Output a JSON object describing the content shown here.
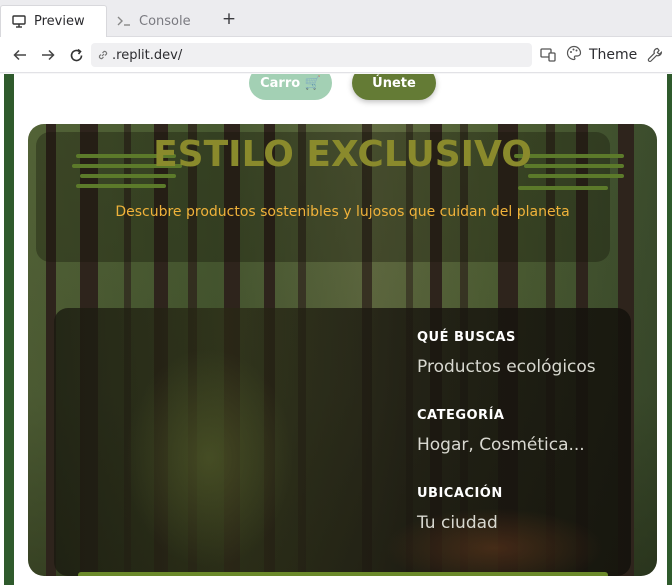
{
  "browser": {
    "tabs": [
      {
        "label": "Preview",
        "icon": "monitor-icon",
        "active": true
      },
      {
        "label": "Console",
        "icon": "terminal-icon",
        "active": false
      }
    ],
    "new_tab": "+",
    "url": ".replit.dev/",
    "theme_label": "Theme"
  },
  "page": {
    "buttons": {
      "cart": "Carro 🛒",
      "join": "Únete"
    },
    "hero": {
      "title": "ESTILO EXCLUSIVO",
      "subtitle": "Descubre productos sostenibles y lujosos que cuidan del planeta"
    },
    "form": {
      "fields": [
        {
          "label": "QUÉ BUSCAS",
          "value": "Productos ecológicos"
        },
        {
          "label": "CATEGORÍA",
          "value": "Hogar, Cosmética..."
        },
        {
          "label": "UBICACIÓN",
          "value": "Tu ciudad"
        }
      ]
    }
  },
  "colors": {
    "brand_green": "#2f5a2c",
    "join_button": "#647b35",
    "cart_button": "#a3d0b4",
    "title": "#8a8a2c",
    "subtitle": "#f0b23a"
  }
}
